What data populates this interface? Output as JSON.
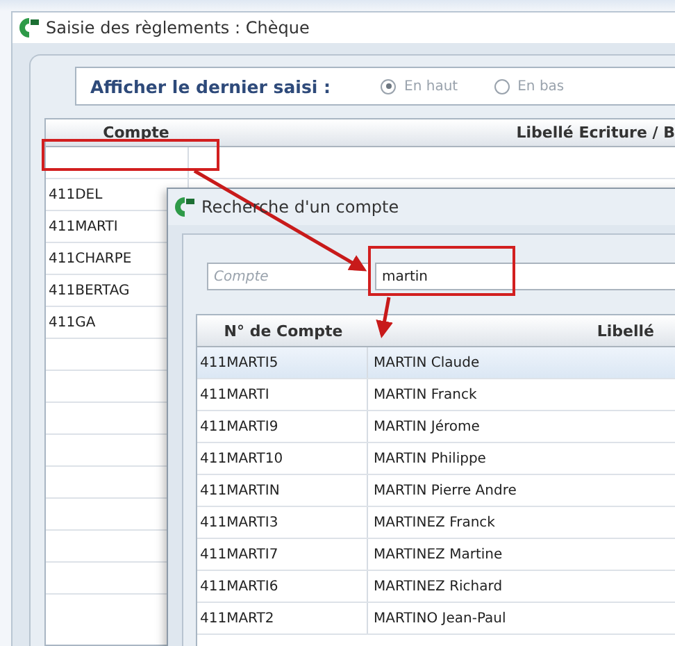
{
  "main_window": {
    "title": "Saisie des règlements : Chèque",
    "display_option": {
      "label": "Afficher le dernier saisi :",
      "options": [
        {
          "label": "En haut",
          "selected": true
        },
        {
          "label": "En bas",
          "selected": false
        }
      ]
    },
    "table": {
      "columns": [
        "Compte",
        "Libellé Ecriture / B"
      ],
      "rows": [
        "411DEL",
        "411MARTI",
        "411CHARPE",
        "411BERTAG",
        "411GA"
      ]
    }
  },
  "dialog": {
    "title": "Recherche d'un compte",
    "search": {
      "placeholder": "Compte",
      "value": "martin"
    },
    "table": {
      "columns": [
        "N° de Compte",
        "Libellé"
      ],
      "rows": [
        {
          "account": "411MARTI5",
          "label": "MARTIN Claude",
          "selected": true
        },
        {
          "account": "411MARTI",
          "label": "MARTIN Franck",
          "selected": false
        },
        {
          "account": "411MARTI9",
          "label": "MARTIN Jérome",
          "selected": false
        },
        {
          "account": "411MART10",
          "label": "MARTIN Philippe",
          "selected": false
        },
        {
          "account": "411MARTIN",
          "label": "MARTIN Pierre Andre",
          "selected": false
        },
        {
          "account": "411MARTI3",
          "label": "MARTINEZ Franck",
          "selected": false
        },
        {
          "account": "411MARTI7",
          "label": "MARTINEZ Martine",
          "selected": false
        },
        {
          "account": "411MARTI6",
          "label": "MARTINEZ Richard",
          "selected": false
        },
        {
          "account": "411MART2",
          "label": "MARTINO Jean-Paul",
          "selected": false
        }
      ]
    }
  }
}
